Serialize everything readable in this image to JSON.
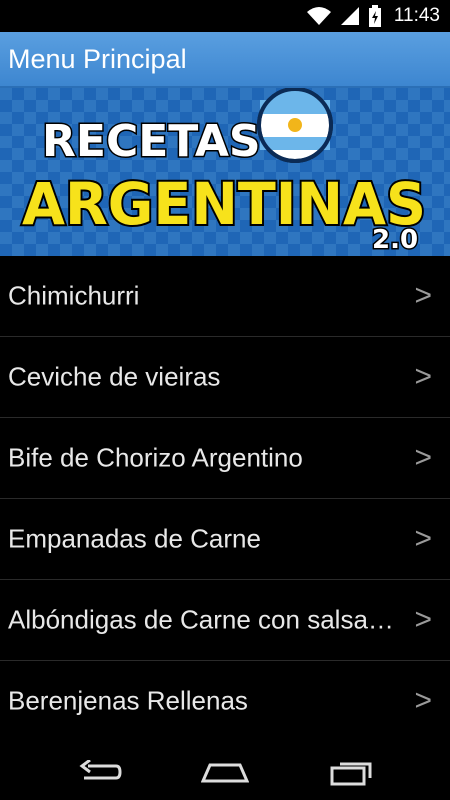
{
  "status_bar": {
    "time": "11:43"
  },
  "header": {
    "title": "Menu Principal"
  },
  "banner": {
    "line1": "RECETAS",
    "line2": "ARGENTINAS",
    "version": "2.0"
  },
  "recipes": [
    {
      "label": "Chimichurri"
    },
    {
      "label": "Ceviche de vieiras"
    },
    {
      "label": "Bife de Chorizo Argentino"
    },
    {
      "label": "Empanadas de Carne"
    },
    {
      "label": "Albóndigas de Carne con salsa de tomate"
    },
    {
      "label": "Berenjenas Rellenas"
    }
  ],
  "chevron_glyph": ">",
  "colors": {
    "header_bg": "#3d86d0",
    "banner_yellow": "#f7e21b",
    "background": "#000000"
  },
  "nav_bar": {
    "back": "back-icon",
    "home": "home-icon",
    "recents": "recents-icon"
  }
}
